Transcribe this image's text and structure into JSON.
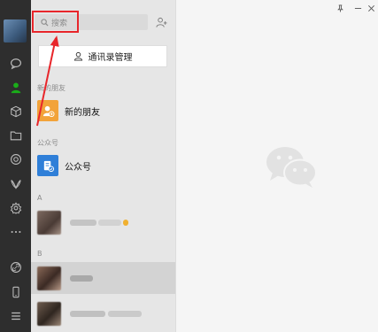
{
  "search": {
    "placeholder": "搜索"
  },
  "contact_manager": {
    "label": "通讯录管理"
  },
  "sections": {
    "new_friends_header": "新的朋友",
    "official_header": "公众号",
    "letter_a": "A",
    "letter_b": "B"
  },
  "items": {
    "new_friends": "新的朋友",
    "official_accounts": "公众号"
  },
  "colors": {
    "rail_bg": "#2e2e2e",
    "list_bg": "#e6e6e6",
    "active_green": "#1aad19",
    "new_friend_orange": "#f2a33a",
    "official_blue": "#2f7fd8",
    "annotation_red": "#e8262b"
  },
  "icons": [
    "chat-icon",
    "contacts-icon",
    "favorites-icon",
    "files-icon",
    "moments-icon",
    "mini-program-icon",
    "settings-gear-icon",
    "more-icon",
    "link-icon",
    "phone-icon",
    "menu-icon",
    "add-contact-icon",
    "pin-icon",
    "minimize-icon",
    "close-icon",
    "wechat-logo-icon"
  ]
}
